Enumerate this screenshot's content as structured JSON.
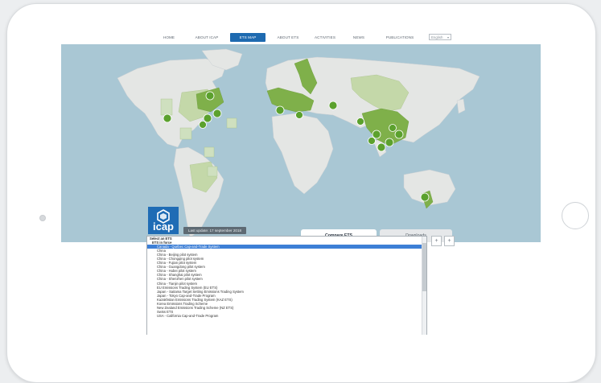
{
  "nav": {
    "items": [
      {
        "label": "HOME",
        "active": false
      },
      {
        "label": "ABOUT ICAP",
        "active": false
      },
      {
        "label": "ETS MAP",
        "active": true
      },
      {
        "label": "ABOUT ETS",
        "active": false
      },
      {
        "label": "ACTIVITIES",
        "active": false
      },
      {
        "label": "NEWS",
        "active": false
      },
      {
        "label": "PUBLICATIONS",
        "active": false
      }
    ],
    "language": "English",
    "accent_color": "#1e6ab0"
  },
  "map": {
    "logo_text": "icap",
    "logo_icon": "icap-hexagon-icon",
    "last_update": "Last update: 17 september 2018",
    "marker_icon": "pin-icon",
    "colors": {
      "ocean": "#a9c7d4",
      "land": "#e4e6e4",
      "ets_in_force": "#7fb04a",
      "ets_planned": "#c4d8a9"
    }
  },
  "tabs": [
    {
      "label": "Compare ETS",
      "active": true
    },
    {
      "label": "Downloads",
      "active": false
    }
  ],
  "list": {
    "items": [
      {
        "label": "Select an ETS",
        "type": "group"
      },
      {
        "label": "ETS in force",
        "type": "group2"
      },
      {
        "label": "Canada - Québec Cap-and-Trade System",
        "type": "selected"
      },
      {
        "label": "China",
        "type": "item"
      },
      {
        "label": "China - Beijing pilot system",
        "type": "item"
      },
      {
        "label": "China - Chongqing pilot system",
        "type": "item"
      },
      {
        "label": "China - Fujian pilot system",
        "type": "item"
      },
      {
        "label": "China - Guangdong pilot system",
        "type": "item"
      },
      {
        "label": "China - Hubei pilot system",
        "type": "item"
      },
      {
        "label": "China - Shanghai pilot system",
        "type": "item"
      },
      {
        "label": "China - Shenzhen pilot system",
        "type": "item"
      },
      {
        "label": "China - Tianjin pilot system",
        "type": "item"
      },
      {
        "label": "EU Emissions Trading System (EU ETS)",
        "type": "item"
      },
      {
        "label": "Japan - Saitama Target Setting Emissions Trading System",
        "type": "item"
      },
      {
        "label": "Japan - Tokyo Cap-and-Trade Program",
        "type": "item"
      },
      {
        "label": "Kazakhstan Emissions Trading System (KAZ ETS)",
        "type": "item"
      },
      {
        "label": "Korea Emissions Trading Scheme",
        "type": "item"
      },
      {
        "label": "New Zealand Emissions Trading Scheme (NZ ETS)",
        "type": "item"
      },
      {
        "label": "Swiss ETS",
        "type": "item"
      },
      {
        "label": "USA - California Cap-and-Trade Program",
        "type": "item"
      }
    ],
    "add_button": "+",
    "add_button_2": "+"
  }
}
